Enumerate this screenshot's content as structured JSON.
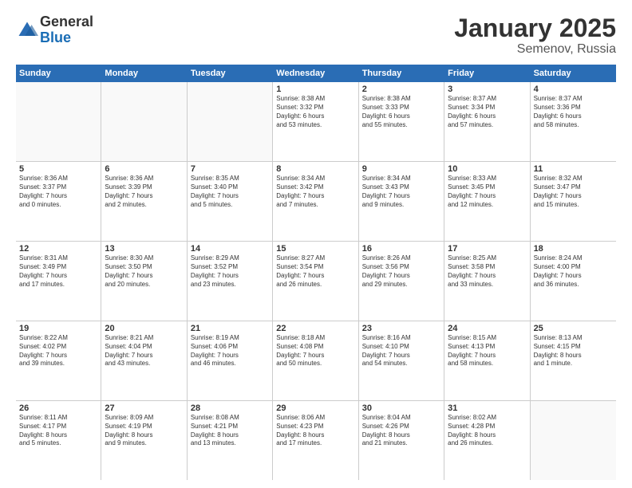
{
  "logo": {
    "general": "General",
    "blue": "Blue"
  },
  "title": "January 2025",
  "location": "Semenov, Russia",
  "header_days": [
    "Sunday",
    "Monday",
    "Tuesday",
    "Wednesday",
    "Thursday",
    "Friday",
    "Saturday"
  ],
  "weeks": [
    [
      {
        "day": "",
        "text": ""
      },
      {
        "day": "",
        "text": ""
      },
      {
        "day": "",
        "text": ""
      },
      {
        "day": "1",
        "text": "Sunrise: 8:38 AM\nSunset: 3:32 PM\nDaylight: 6 hours\nand 53 minutes."
      },
      {
        "day": "2",
        "text": "Sunrise: 8:38 AM\nSunset: 3:33 PM\nDaylight: 6 hours\nand 55 minutes."
      },
      {
        "day": "3",
        "text": "Sunrise: 8:37 AM\nSunset: 3:34 PM\nDaylight: 6 hours\nand 57 minutes."
      },
      {
        "day": "4",
        "text": "Sunrise: 8:37 AM\nSunset: 3:36 PM\nDaylight: 6 hours\nand 58 minutes."
      }
    ],
    [
      {
        "day": "5",
        "text": "Sunrise: 8:36 AM\nSunset: 3:37 PM\nDaylight: 7 hours\nand 0 minutes."
      },
      {
        "day": "6",
        "text": "Sunrise: 8:36 AM\nSunset: 3:39 PM\nDaylight: 7 hours\nand 2 minutes."
      },
      {
        "day": "7",
        "text": "Sunrise: 8:35 AM\nSunset: 3:40 PM\nDaylight: 7 hours\nand 5 minutes."
      },
      {
        "day": "8",
        "text": "Sunrise: 8:34 AM\nSunset: 3:42 PM\nDaylight: 7 hours\nand 7 minutes."
      },
      {
        "day": "9",
        "text": "Sunrise: 8:34 AM\nSunset: 3:43 PM\nDaylight: 7 hours\nand 9 minutes."
      },
      {
        "day": "10",
        "text": "Sunrise: 8:33 AM\nSunset: 3:45 PM\nDaylight: 7 hours\nand 12 minutes."
      },
      {
        "day": "11",
        "text": "Sunrise: 8:32 AM\nSunset: 3:47 PM\nDaylight: 7 hours\nand 15 minutes."
      }
    ],
    [
      {
        "day": "12",
        "text": "Sunrise: 8:31 AM\nSunset: 3:49 PM\nDaylight: 7 hours\nand 17 minutes."
      },
      {
        "day": "13",
        "text": "Sunrise: 8:30 AM\nSunset: 3:50 PM\nDaylight: 7 hours\nand 20 minutes."
      },
      {
        "day": "14",
        "text": "Sunrise: 8:29 AM\nSunset: 3:52 PM\nDaylight: 7 hours\nand 23 minutes."
      },
      {
        "day": "15",
        "text": "Sunrise: 8:27 AM\nSunset: 3:54 PM\nDaylight: 7 hours\nand 26 minutes."
      },
      {
        "day": "16",
        "text": "Sunrise: 8:26 AM\nSunset: 3:56 PM\nDaylight: 7 hours\nand 29 minutes."
      },
      {
        "day": "17",
        "text": "Sunrise: 8:25 AM\nSunset: 3:58 PM\nDaylight: 7 hours\nand 33 minutes."
      },
      {
        "day": "18",
        "text": "Sunrise: 8:24 AM\nSunset: 4:00 PM\nDaylight: 7 hours\nand 36 minutes."
      }
    ],
    [
      {
        "day": "19",
        "text": "Sunrise: 8:22 AM\nSunset: 4:02 PM\nDaylight: 7 hours\nand 39 minutes."
      },
      {
        "day": "20",
        "text": "Sunrise: 8:21 AM\nSunset: 4:04 PM\nDaylight: 7 hours\nand 43 minutes."
      },
      {
        "day": "21",
        "text": "Sunrise: 8:19 AM\nSunset: 4:06 PM\nDaylight: 7 hours\nand 46 minutes."
      },
      {
        "day": "22",
        "text": "Sunrise: 8:18 AM\nSunset: 4:08 PM\nDaylight: 7 hours\nand 50 minutes."
      },
      {
        "day": "23",
        "text": "Sunrise: 8:16 AM\nSunset: 4:10 PM\nDaylight: 7 hours\nand 54 minutes."
      },
      {
        "day": "24",
        "text": "Sunrise: 8:15 AM\nSunset: 4:13 PM\nDaylight: 7 hours\nand 58 minutes."
      },
      {
        "day": "25",
        "text": "Sunrise: 8:13 AM\nSunset: 4:15 PM\nDaylight: 8 hours\nand 1 minute."
      }
    ],
    [
      {
        "day": "26",
        "text": "Sunrise: 8:11 AM\nSunset: 4:17 PM\nDaylight: 8 hours\nand 5 minutes."
      },
      {
        "day": "27",
        "text": "Sunrise: 8:09 AM\nSunset: 4:19 PM\nDaylight: 8 hours\nand 9 minutes."
      },
      {
        "day": "28",
        "text": "Sunrise: 8:08 AM\nSunset: 4:21 PM\nDaylight: 8 hours\nand 13 minutes."
      },
      {
        "day": "29",
        "text": "Sunrise: 8:06 AM\nSunset: 4:23 PM\nDaylight: 8 hours\nand 17 minutes."
      },
      {
        "day": "30",
        "text": "Sunrise: 8:04 AM\nSunset: 4:26 PM\nDaylight: 8 hours\nand 21 minutes."
      },
      {
        "day": "31",
        "text": "Sunrise: 8:02 AM\nSunset: 4:28 PM\nDaylight: 8 hours\nand 26 minutes."
      },
      {
        "day": "",
        "text": ""
      }
    ]
  ]
}
